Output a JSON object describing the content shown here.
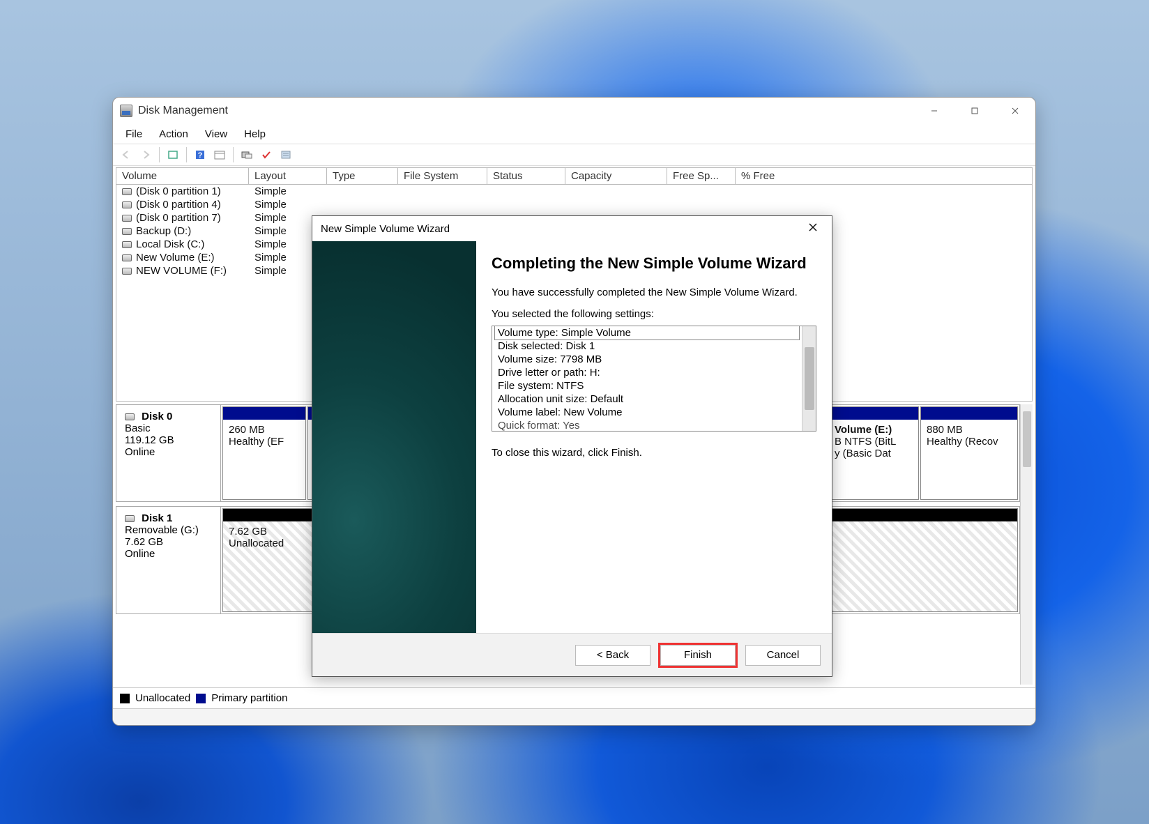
{
  "app": {
    "title": "Disk Management"
  },
  "menu": {
    "file": "File",
    "action": "Action",
    "view": "View",
    "help": "Help"
  },
  "columns": {
    "volume": "Volume",
    "layout": "Layout",
    "type": "Type",
    "fs": "File System",
    "status": "Status",
    "capacity": "Capacity",
    "free": "Free Sp...",
    "pct": "% Free"
  },
  "volumes": [
    {
      "name": "(Disk 0 partition 1)",
      "layout": "Simple"
    },
    {
      "name": "(Disk 0 partition 4)",
      "layout": "Simple"
    },
    {
      "name": "(Disk 0 partition 7)",
      "layout": "Simple"
    },
    {
      "name": "Backup (D:)",
      "layout": "Simple"
    },
    {
      "name": "Local Disk (C:)",
      "layout": "Simple"
    },
    {
      "name": "New Volume (E:)",
      "layout": "Simple"
    },
    {
      "name": "NEW VOLUME (F:)",
      "layout": "Simple"
    }
  ],
  "disk0": {
    "name": "Disk 0",
    "type": "Basic",
    "size": "119.12 GB",
    "status": "Online",
    "p1": {
      "size": "260 MB",
      "status": "Healthy (EF"
    },
    "pE": {
      "name": "Volume  (E:)",
      "fs": "B NTFS (BitL",
      "status": "y (Basic Dat"
    },
    "pR": {
      "size": "880 MB",
      "status": "Healthy (Recov"
    }
  },
  "disk1": {
    "name": "Disk 1",
    "type": "Removable (G:)",
    "size": "7.62 GB",
    "status": "Online",
    "p1": {
      "size": "7.62 GB",
      "status": "Unallocated"
    }
  },
  "legend": {
    "unalloc": "Unallocated",
    "primary": "Primary partition"
  },
  "wizard": {
    "title": "New Simple Volume Wizard",
    "heading": "Completing the New Simple Volume Wizard",
    "completed": "You have successfully completed the New Simple Volume Wizard.",
    "selected": "You selected the following settings:",
    "settings": [
      "Volume type: Simple Volume",
      "Disk selected: Disk 1",
      "Volume size: 7798 MB",
      "Drive letter or path: H:",
      "File system: NTFS",
      "Allocation unit size: Default",
      "Volume label: New Volume",
      "Quick format: Yes"
    ],
    "close_hint": "To close this wizard, click Finish.",
    "back": "< Back",
    "finish": "Finish",
    "cancel": "Cancel"
  }
}
